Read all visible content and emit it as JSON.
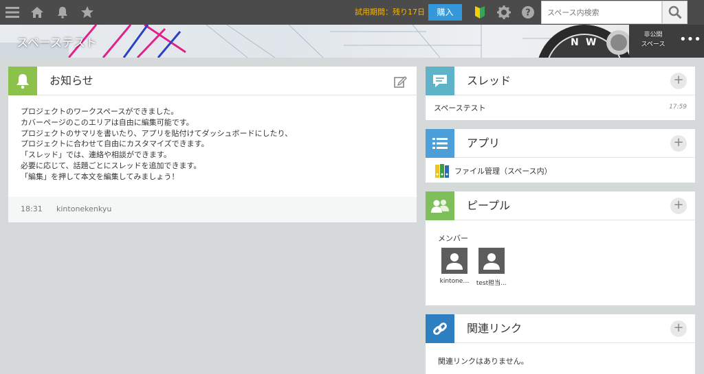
{
  "topbar": {
    "menu_icon": "hamburger-icon",
    "home_icon": "home-icon",
    "notification_icon": "bell-icon",
    "favorite_icon": "star-icon",
    "trial_text": "試用期間：残り17日",
    "buy_label": "購入",
    "beginner_icon": "beginner-mark-icon",
    "settings_icon": "gear-icon",
    "help_icon": "help-icon",
    "search": {
      "placeholder": "スペース内検索",
      "value": ""
    }
  },
  "banner": {
    "title": "スペーステスト",
    "status_line1": "非公開",
    "status_line2": "スペース",
    "more_icon": "more-dots-icon"
  },
  "notice": {
    "title": "お知らせ",
    "icon": "bell-icon",
    "edit_icon": "edit-icon",
    "lines": [
      "プロジェクトのワークスペースができました。",
      "カバーページのこのエリアは自由に編集可能です。",
      "プロジェクトのサマリを書いたり、アプリを貼付けてダッシュボードにしたり、",
      "プロジェクトに合わせて自由にカスタマイズできます。",
      "「スレッド」では、連絡や相談ができます。",
      "必要に応じて、話題ごとにスレッドを追加できます。",
      "「編集」を押して本文を編集してみましょう！"
    ],
    "footer_time": "18:31",
    "footer_user": "kintonekenkyu"
  },
  "threads": {
    "title": "スレッド",
    "icon": "chat-bubble-icon",
    "items": [
      {
        "name": "スペーステスト",
        "time": "17:59"
      }
    ]
  },
  "apps": {
    "title": "アプリ",
    "icon": "list-icon",
    "items": [
      {
        "name": "ファイル管理（スペース内）",
        "icon": "binder-icon"
      }
    ]
  },
  "people": {
    "title": "ピープル",
    "icon": "people-icon",
    "members_label": "メンバー",
    "members": [
      {
        "name": "kintone…"
      },
      {
        "name": "test担当…"
      }
    ]
  },
  "links": {
    "title": "関連リンク",
    "icon": "link-icon",
    "empty_text": "関連リンクはありません。"
  },
  "colors": {
    "topbar": "#4b4b4b",
    "trial": "#f7b500",
    "buy_button": "#3498db",
    "notice_icon_bg": "#8cc14c",
    "threads_icon_bg": "#5fb3c8",
    "apps_icon_bg": "#4c9fd8",
    "people_icon_bg": "#7fbf5a",
    "links_icon_bg": "#2e7fc1"
  }
}
